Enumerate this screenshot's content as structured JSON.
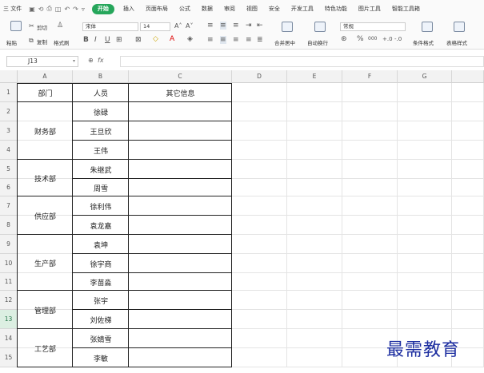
{
  "ribbon": {
    "menu_label": "三 文件",
    "tabs": [
      "开始",
      "插入",
      "页面布局",
      "公式",
      "数据",
      "审阅",
      "视图",
      "安全",
      "开发工具",
      "特色功能",
      "图片工具",
      "智能工具箱"
    ],
    "active_tab": "开始",
    "accent_color": "#26a65b"
  },
  "toolbar": {
    "paste": "粘贴",
    "cut": "剪切",
    "copy": "复制",
    "format_painter": "格式刷",
    "font_name": "宋体",
    "font_size": "14",
    "bold": "B",
    "italic": "I",
    "underline": "U",
    "merge_center": "合并居中",
    "wrap_text": "自动换行",
    "number_format": "常规",
    "percent": "%",
    "thousands": "000",
    "cond_format": "条件格式",
    "table_style": "表格样式"
  },
  "formula_bar": {
    "name_box": "J13",
    "fx": "fx",
    "value": ""
  },
  "columns": [
    "A",
    "B",
    "C",
    "D",
    "E",
    "F",
    "G"
  ],
  "rows": [
    "1",
    "2",
    "3",
    "4",
    "5",
    "6",
    "7",
    "8",
    "9",
    "10",
    "11",
    "12",
    "13",
    "14",
    "15"
  ],
  "selected_row": "13",
  "table": {
    "headers": [
      "部门",
      "人员",
      "其它信息"
    ],
    "departments": [
      "财务部",
      "技术部",
      "供应部",
      "生产部",
      "管理部",
      "工艺部"
    ],
    "people": [
      "徐碌",
      "王旦欣",
      "王伟",
      "朱继武",
      "周雪",
      "徐利伟",
      "袁龙嘉",
      "袁坤",
      "徐宇商",
      "李苗淼",
      "张宇",
      "刘佐梯",
      "张婧雪",
      "李敏"
    ]
  },
  "watermark": "最需教育"
}
